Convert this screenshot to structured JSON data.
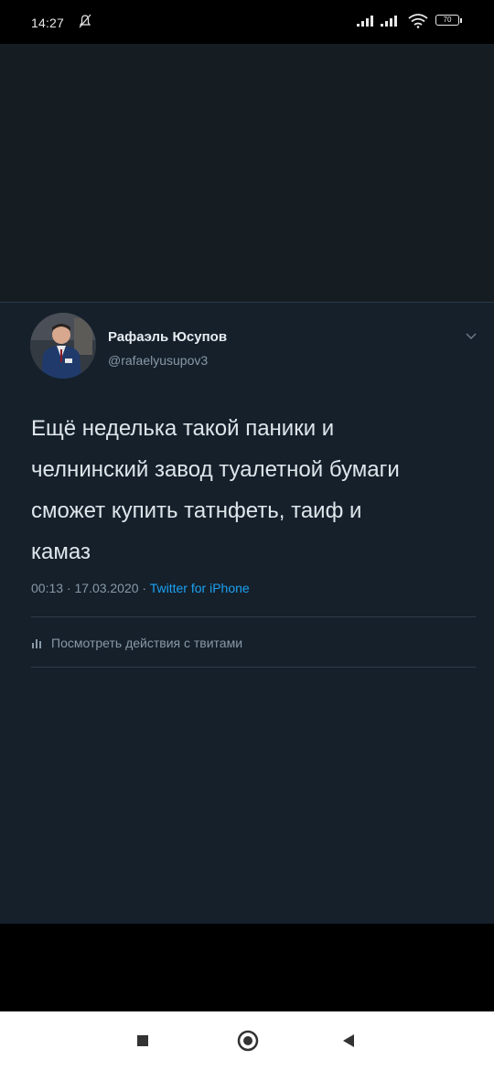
{
  "status_bar": {
    "time": "14:27",
    "battery": "70",
    "icons": [
      "mute-icon",
      "signal-icon",
      "signal-icon",
      "wifi-icon",
      "battery-icon"
    ]
  },
  "tweet": {
    "author": {
      "name": "Рафаэль Юсупов",
      "handle": "@rafaelyusupov3"
    },
    "text": "Ещё неделька  такой паники и\nчелнинский завод туалетной бумаги\nсможет купить татнфеть, таиф и\nкамаз",
    "timestamp": "00:13 · 17.03.2020 · ",
    "source": "Twitter for iPhone",
    "activity_label": "Посмотреть действия с твитами",
    "menu_icon": "chevron-down-icon",
    "colors": {
      "background": "#15202b",
      "text": "#dfe6eb",
      "secondary": "#8899a6",
      "link": "#1da1f2"
    }
  },
  "nav_bar": {
    "buttons": [
      "recents-icon",
      "home-icon",
      "back-icon"
    ]
  }
}
